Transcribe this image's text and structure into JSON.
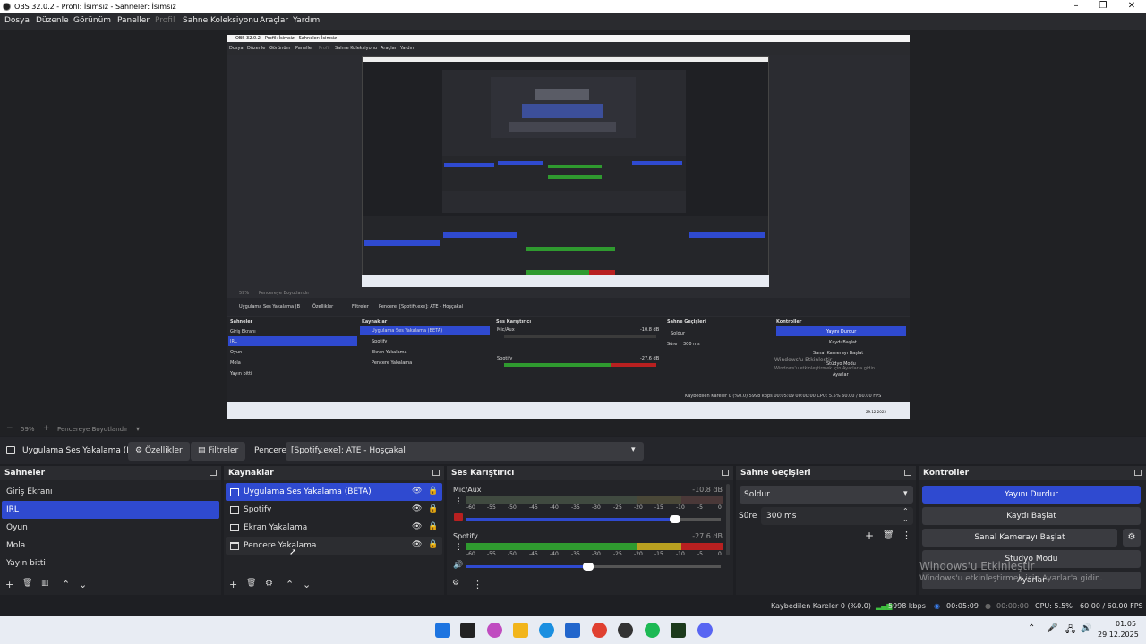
{
  "window": {
    "title": "OBS 32.0.2 - Profil: İsimsiz - Sahneler: İsimsiz",
    "controls": [
      "–",
      "❐",
      "✕"
    ]
  },
  "menu": {
    "items": [
      {
        "label": "Dosya",
        "enabled": true
      },
      {
        "label": "Düzenle",
        "enabled": true
      },
      {
        "label": "Görünüm",
        "enabled": true
      },
      {
        "label": "Paneller",
        "enabled": true
      },
      {
        "label": "Profil",
        "enabled": false
      },
      {
        "label": "Sahne Koleksiyonu",
        "enabled": true
      },
      {
        "label": "Araçlar",
        "enabled": true
      },
      {
        "label": "Yardım",
        "enabled": true
      }
    ]
  },
  "preview": {
    "nested_title": "OBS 32.0.2 - Profil: İsimsiz - Sahneler: İsimsiz",
    "nested_menu": [
      "Dosya",
      "Düzenle",
      "Görünüm",
      "Paneller",
      "Profil",
      "Sahne Koleksiyonu",
      "Araçlar",
      "Yardım"
    ],
    "nested_zoom": "59%",
    "nested_fit": "Pencereye Boyutlandır",
    "nested_source_name": "Uygulama Ses Yakalama (B",
    "nested_props": "Özellikler",
    "nested_filters": "Filtreler",
    "nested_window_label": "Pencere",
    "nested_window_value": "[Spotify.exe]: ATE - Hoşçakal",
    "nested_scenes_title": "Sahneler",
    "nested_scenes": [
      "Giriş Ekranı",
      "IRL",
      "Oyun",
      "Mola",
      "Yayın bitti"
    ],
    "nested_sources_title": "Kaynaklar",
    "nested_sources": [
      "Uygulama Ses Yakalama (BETA)",
      "Spotify",
      "Ekran Yakalama",
      "Pencere Yakalama"
    ],
    "nested_mixer_title": "Ses Karıştırıcı",
    "nested_mic": "Mic/Aux",
    "nested_mic_db": "-10.8 dB",
    "nested_spotify": "Spotify",
    "nested_spotify_db": "-27.6 dB",
    "nested_transitions_title": "Sahne Geçişleri",
    "nested_transition": "Soldur",
    "nested_duration_label": "Süre",
    "nested_duration": "300 ms",
    "nested_controls_title": "Kontroller",
    "nested_controls": [
      "Yayını Durdur",
      "Kaydı Başlat",
      "Sanal Kamerayı Başlat",
      "Stüdyo Modu",
      "Ayarlar"
    ],
    "nested_watermark1": "Windows'u Etkinleştir",
    "nested_watermark2": "Windows'u etkinleştirmek için Ayarlar'a gidin.",
    "nested_status": "Kaybedilen Kareler 0 (%0.0)   5998 kbps   00:05:09   00:00:00   CPU: 5.5%   60.00 / 60.00 FPS",
    "nested_date": "29.12.2025"
  },
  "zoom": {
    "minus": "−",
    "value": "59%",
    "plus": "+",
    "fit_label": "Pencereye Boyutlandır",
    "fit_arrow": "▾"
  },
  "source_toolbar": {
    "source_name": "Uygulama Ses Yakalama (Bl",
    "properties": "Özellikler",
    "filters": "Filtreler",
    "window_label": "Pencere",
    "window_value": "[Spotify.exe]: ATE - Hoşçakal"
  },
  "scenes": {
    "title": "Sahneler",
    "items": [
      {
        "label": "Giriş Ekranı",
        "selected": false
      },
      {
        "label": "IRL",
        "selected": true
      },
      {
        "label": "Oyun",
        "selected": false
      },
      {
        "label": "Mola",
        "selected": false
      },
      {
        "label": "Yayın bitti",
        "selected": false
      }
    ],
    "footer": [
      "+",
      "🗑",
      "▥",
      "⌃",
      "⌄"
    ]
  },
  "sources": {
    "title": "Kaynaklar",
    "items": [
      {
        "label": "Uygulama Ses Yakalama (BETA)",
        "icon": "audio-capture-icon",
        "selected": true
      },
      {
        "label": "Spotify",
        "icon": "window-icon",
        "selected": false
      },
      {
        "label": "Ekran Yakalama",
        "icon": "monitor-icon",
        "selected": false
      },
      {
        "label": "Pencere Yakalama",
        "icon": "window-icon",
        "selected": false
      }
    ],
    "footer": [
      "+",
      "🗑",
      "⚙",
      "⌃",
      "⌄"
    ]
  },
  "mixer": {
    "title": "Ses Karıştırıcı",
    "channels": [
      {
        "name": "Mic/Aux",
        "db": "-10.8 dB",
        "volume": 0.82,
        "level": 0.0
      },
      {
        "name": "Spotify",
        "db": "-27.6 dB",
        "volume": 0.48,
        "level": 0.85
      }
    ],
    "ticks": [
      "-60",
      "-55",
      "-50",
      "-45",
      "-40",
      "-35",
      "-30",
      "-25",
      "-20",
      "-15",
      "-10",
      "-5",
      "0"
    ]
  },
  "transitions": {
    "title": "Sahne Geçişleri",
    "selected": "Soldur",
    "duration_label": "Süre",
    "duration": "300 ms"
  },
  "controls": {
    "title": "Kontroller",
    "stream": "Yayını Durdur",
    "record": "Kaydı Başlat",
    "virtualcam": "Sanal Kamerayı Başlat",
    "studio": "Stüdyo Modu",
    "settings": "Ayarlar"
  },
  "watermark": {
    "line1": "Windows'u Etkinleştir",
    "line2": "Windows'u etkinleştirmek için Ayarlar'a gidin."
  },
  "status": {
    "dropped": "Kaybedilen Kareler 0 (%0.0)",
    "bitrate": "5998 kbps",
    "stream_time": "00:05:09",
    "record_time": "00:00:00",
    "cpu": "CPU: 5.5%",
    "fps": "60.00 / 60.00 FPS"
  },
  "taskbar": {
    "time": "01:05",
    "date": "29.12.2025"
  },
  "colors": {
    "accent": "#2f4ad0",
    "meter_green": "#2f9a2f",
    "meter_yellow": "#b9a020",
    "meter_red": "#b82020"
  }
}
